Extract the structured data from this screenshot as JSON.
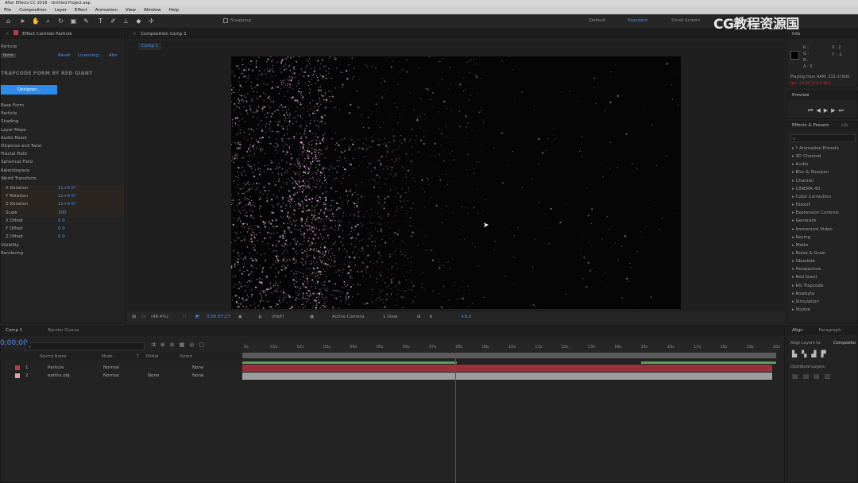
{
  "app": {
    "title": "After Effects CC 2018 - Untitled Project.aep"
  },
  "menu": [
    "File",
    "Composition",
    "Layer",
    "Effect",
    "Animation",
    "View",
    "Window",
    "Help"
  ],
  "toolbar": {
    "snapping_label": "Snapping",
    "workspaces": [
      "Default",
      "Standard",
      "Small Screen"
    ],
    "active_workspace": "Standard"
  },
  "watermark": "CG教程资源国",
  "effect_controls": {
    "tab_title": "Effect Controls Particle",
    "layer_name": "Particle",
    "effect_tag": "form",
    "reset_label": "Reset",
    "licensing_label": "Licensing...",
    "about_label": "Abo",
    "brand": "TRAPCODE FORM BY RED GIANT",
    "designer_button": "Designer...",
    "groups": [
      "Base Form",
      "Particle",
      "Shading",
      "Layer Maps",
      "Audio React",
      "Disperse and Twist",
      "Fractal Field",
      "Spherical Field",
      "Kaleidospace",
      "World Transform"
    ],
    "properties": [
      {
        "name": "X Rotation",
        "value": "1x+0.0°"
      },
      {
        "name": "Y Rotation",
        "value": "1x+0.0°"
      },
      {
        "name": "Z Rotation",
        "value": "1x+0.0°"
      },
      {
        "name": "Scale",
        "value": "300"
      },
      {
        "name": "X Offset",
        "value": "0.0"
      },
      {
        "name": "Y Offset",
        "value": "0.0"
      },
      {
        "name": "Z Offset",
        "value": "0.0"
      }
    ],
    "tail": [
      "Visibility",
      "Rendering"
    ]
  },
  "composition": {
    "tab_title": "Composition Comp 1",
    "breadcrumb": "Comp 1",
    "zoom": "(49.4%)",
    "timecode": "0;00;07;27",
    "resolution": "(Half)",
    "camera": "Active Camera",
    "views": "1 View",
    "exposure": "+0.0"
  },
  "info": {
    "tab": "Info",
    "rgba": [
      "R :",
      "G :",
      "B :",
      "A : 0"
    ],
    "xy": [
      "X : 2",
      "Y : -1"
    ],
    "ram_status": "Playing from RAM: 231 of 600",
    "ram_warning": "fps: 24.00 (10.0 fps)"
  },
  "preview": {
    "tab": "Preview"
  },
  "effects_presets": {
    "tab": "Effects & Presets",
    "tab2": "Lib",
    "categories": [
      "* Animation Presets",
      "3D Channel",
      "Audio",
      "Blur & Sharpen",
      "Channel",
      "CINEMA 4D",
      "Color Correction",
      "Distort",
      "Expression Controls",
      "Generate",
      "Immersive Video",
      "Keying",
      "Matte",
      "Noise & Grain",
      "Obsolete",
      "Perspective",
      "Red Giant",
      "RG Trapcode",
      "Rowbyte",
      "Simulation",
      "Stylize"
    ]
  },
  "align": {
    "tab": "Align",
    "tab2": "Paragraph",
    "align_to_label": "Align Layers to:",
    "align_to_value": "Compositio",
    "distribute_label": "Distribute Layers:"
  },
  "timeline": {
    "tab": "Comp 1",
    "render_queue_tab": "Render Queue",
    "current_time": "0;00;00",
    "columns": [
      "Source Name",
      "Mode",
      "T",
      "TrkMat",
      "Parent"
    ],
    "layers": [
      {
        "index": "1",
        "name": "Particle",
        "mode": "Normal",
        "trkmat": "",
        "parent": "None",
        "color": "#c0394a"
      },
      {
        "index": "2",
        "name": "earths.obj",
        "mode": "Normal",
        "trkmat": "None",
        "parent": "None",
        "color": "#e8a0b0"
      }
    ],
    "ruler": [
      "0s",
      "01s",
      "02s",
      "03s",
      "04s",
      "05s",
      "06s",
      "07s",
      "08s",
      "09s",
      "10s",
      "11s",
      "12s",
      "13s",
      "14s",
      "15s",
      "16s",
      "17s",
      "18s",
      "19s",
      "20s"
    ],
    "playhead_seconds": 8
  },
  "colors": {
    "accent": "#4e8ff0",
    "layer1_track": "#9b2f3b",
    "layer2_track": "#9e9e9e",
    "playhead": "#c1272d",
    "particle": "#d9a6d6"
  }
}
